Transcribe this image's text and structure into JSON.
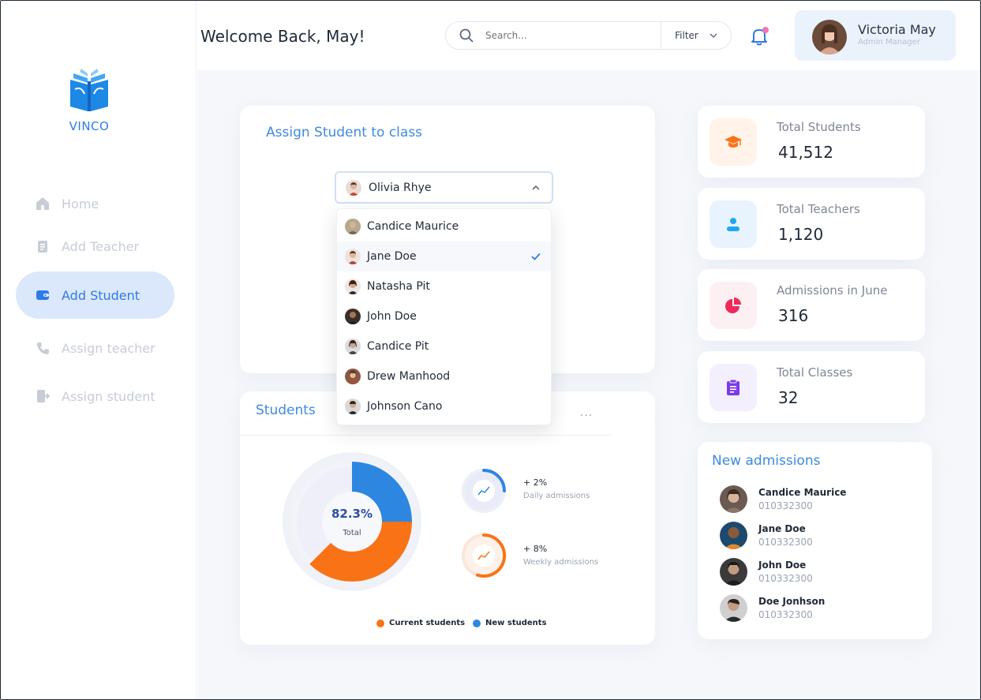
{
  "header": {
    "welcome": "Welcome Back, May!",
    "search_placeholder": "Search...",
    "filter_label": "Filter",
    "notification_count": "1"
  },
  "profile": {
    "name": "Victoria May",
    "role": "Admin Manager"
  },
  "sidebar": {
    "logo_text": "VINCO",
    "items": [
      {
        "label": "Home",
        "icon": "home-icon",
        "active": false
      },
      {
        "label": "Add Teacher",
        "icon": "clipboard-icon",
        "active": false
      },
      {
        "label": "Add Student",
        "icon": "wallet-icon",
        "active": true
      },
      {
        "label": "Assign teacher",
        "icon": "phone-icon",
        "active": false
      },
      {
        "label": "Assign student",
        "icon": "login-icon",
        "active": false
      }
    ]
  },
  "assign": {
    "title": "Assign Student to class",
    "selected": "Olivia Rhye",
    "options": [
      {
        "name": "Candice Maurice",
        "selected": false
      },
      {
        "name": "Jane Doe",
        "selected": true
      },
      {
        "name": "Natasha Pit",
        "selected": false
      },
      {
        "name": "John Doe",
        "selected": false
      },
      {
        "name": "Candice Pit",
        "selected": false
      },
      {
        "name": "Drew Manhood",
        "selected": false
      },
      {
        "name": "Johnson Cano",
        "selected": false
      }
    ]
  },
  "students": {
    "title": "Students",
    "more": "...",
    "total_value": "82.3%",
    "total_label": "Total",
    "daily_value": "+ 2%",
    "daily_label": "Daily admissions",
    "weekly_value": "+ 8%",
    "weekly_label": "Weekly admissions",
    "legend_current": "Current students",
    "legend_new": "New students"
  },
  "chart_data": {
    "type": "pie",
    "title": "Students",
    "center_label": "82.3%",
    "slices": [
      {
        "name": "Current students",
        "color": "#f97316"
      },
      {
        "name": "New students",
        "color": "#2d86e0"
      }
    ],
    "daily_progress": 0.25,
    "weekly_progress": 0.55
  },
  "stats": [
    {
      "title": "Total Students",
      "value": "41,512",
      "icon": "graduation-cap-icon",
      "bg": "#fff3ea",
      "color": "#f97316"
    },
    {
      "title": "Total Teachers",
      "value": "1,120",
      "icon": "user-icon",
      "bg": "#e8f3fd",
      "color": "#1ea7f0"
    },
    {
      "title": "Admissions in June",
      "value": "316",
      "icon": "pie-chart-icon",
      "bg": "#fdf0f3",
      "color": "#ef2a5a"
    },
    {
      "title": "Total Classes",
      "value": "32",
      "icon": "clipboard-list-icon",
      "bg": "#f3effd",
      "color": "#7c3aed"
    }
  ],
  "admissions": {
    "title": "New admissions",
    "items": [
      {
        "name": "Candice Maurice",
        "id": "010332300"
      },
      {
        "name": "Jane Doe",
        "id": "010332300"
      },
      {
        "name": "John Doe",
        "id": "010332300"
      },
      {
        "name": "Doe Jonhson",
        "id": "010332300"
      }
    ]
  },
  "colors": {
    "accent": "#2f7be5",
    "orange": "#f97316",
    "blue": "#2d86e0"
  }
}
